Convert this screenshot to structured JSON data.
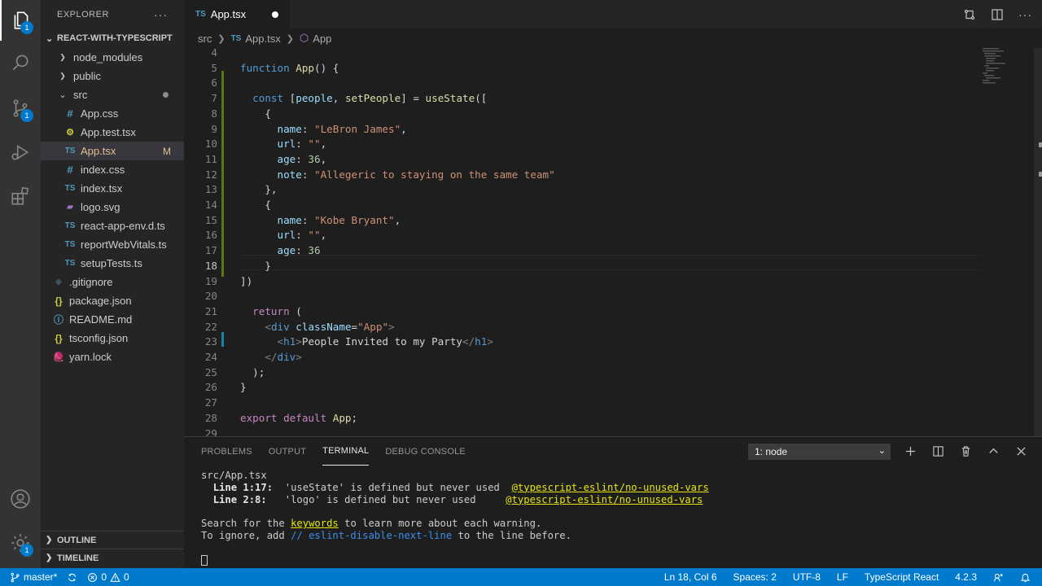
{
  "explorer": {
    "title": "EXPLORER",
    "more": "···",
    "project": "REACT-WITH-TYPESCRIPT",
    "items": [
      {
        "label": "node_modules",
        "type": "folder",
        "icon": ""
      },
      {
        "label": "public",
        "type": "folder",
        "icon": ""
      },
      {
        "label": "src",
        "type": "folder-open",
        "icon": ""
      },
      {
        "label": "App.css",
        "type": "file",
        "icon": "#"
      },
      {
        "label": "App.test.tsx",
        "type": "file",
        "icon": "⚙"
      },
      {
        "label": "App.tsx",
        "type": "file",
        "icon": "TS",
        "badge": "M"
      },
      {
        "label": "index.css",
        "type": "file",
        "icon": "#"
      },
      {
        "label": "index.tsx",
        "type": "file",
        "icon": "TS"
      },
      {
        "label": "logo.svg",
        "type": "file",
        "icon": "▰"
      },
      {
        "label": "react-app-env.d.ts",
        "type": "file",
        "icon": "TS"
      },
      {
        "label": "reportWebVitals.ts",
        "type": "file",
        "icon": "TS"
      },
      {
        "label": "setupTests.ts",
        "type": "file",
        "icon": "TS"
      },
      {
        "label": ".gitignore",
        "type": "file",
        "icon": "◆"
      },
      {
        "label": "package.json",
        "type": "file",
        "icon": "{}"
      },
      {
        "label": "README.md",
        "type": "file",
        "icon": "ⓘ"
      },
      {
        "label": "tsconfig.json",
        "type": "file",
        "icon": "{}"
      },
      {
        "label": "yarn.lock",
        "type": "file",
        "icon": "🧶"
      }
    ],
    "outline": "OUTLINE",
    "timeline": "TIMELINE"
  },
  "activity": {
    "explorer_badge": "1",
    "scm_badge": "1",
    "settings_badge": "1"
  },
  "tab": {
    "icon": "TS",
    "label": "App.tsx"
  },
  "breadcrumb": {
    "folder": "src",
    "file_icon": "TS",
    "file": "App.tsx",
    "symbol": "App"
  },
  "editor": {
    "current_line": "18",
    "line_numbers": [
      "4",
      "5",
      "6",
      "7",
      "8",
      "9",
      "10",
      "11",
      "12",
      "13",
      "14",
      "15",
      "16",
      "17",
      "18",
      "19",
      "20",
      "21",
      "22",
      "23",
      "24",
      "25",
      "26",
      "27",
      "28",
      "29"
    ]
  },
  "panel": {
    "tabs": [
      "PROBLEMS",
      "OUTPUT",
      "TERMINAL",
      "DEBUG CONSOLE"
    ],
    "active_tab": "TERMINAL",
    "terminal_select": "1: node",
    "terminal": {
      "file": "src/App.tsx",
      "w1_loc": "Line 1:17:",
      "w1_msg": "  'useState' is defined but never used  ",
      "w1_rule": "@typescript-eslint/no-unused-vars",
      "w2_loc": "Line 2:8:",
      "w2_msg": "   'logo' is defined but never used     ",
      "w2_rule": "@typescript-eslint/no-unused-vars",
      "search_pre": "Search for the ",
      "search_kw": "keywords",
      "search_post": " to learn more about each warning.",
      "ignore_pre": "To ignore, add ",
      "ignore_kw": "// eslint-disable-next-line",
      "ignore_post": " to the line before."
    }
  },
  "status": {
    "branch": "master*",
    "errors": "0",
    "warnings": "0",
    "position": "Ln 18, Col 6",
    "spaces": "Spaces: 2",
    "encoding": "UTF-8",
    "eol": "LF",
    "language": "TypeScript React",
    "version": "4.2.3"
  },
  "colors": {
    "accent": "#007acc",
    "activity_bg": "#333333",
    "sidebar_bg": "#252526",
    "editor_bg": "#1e1e1e"
  }
}
